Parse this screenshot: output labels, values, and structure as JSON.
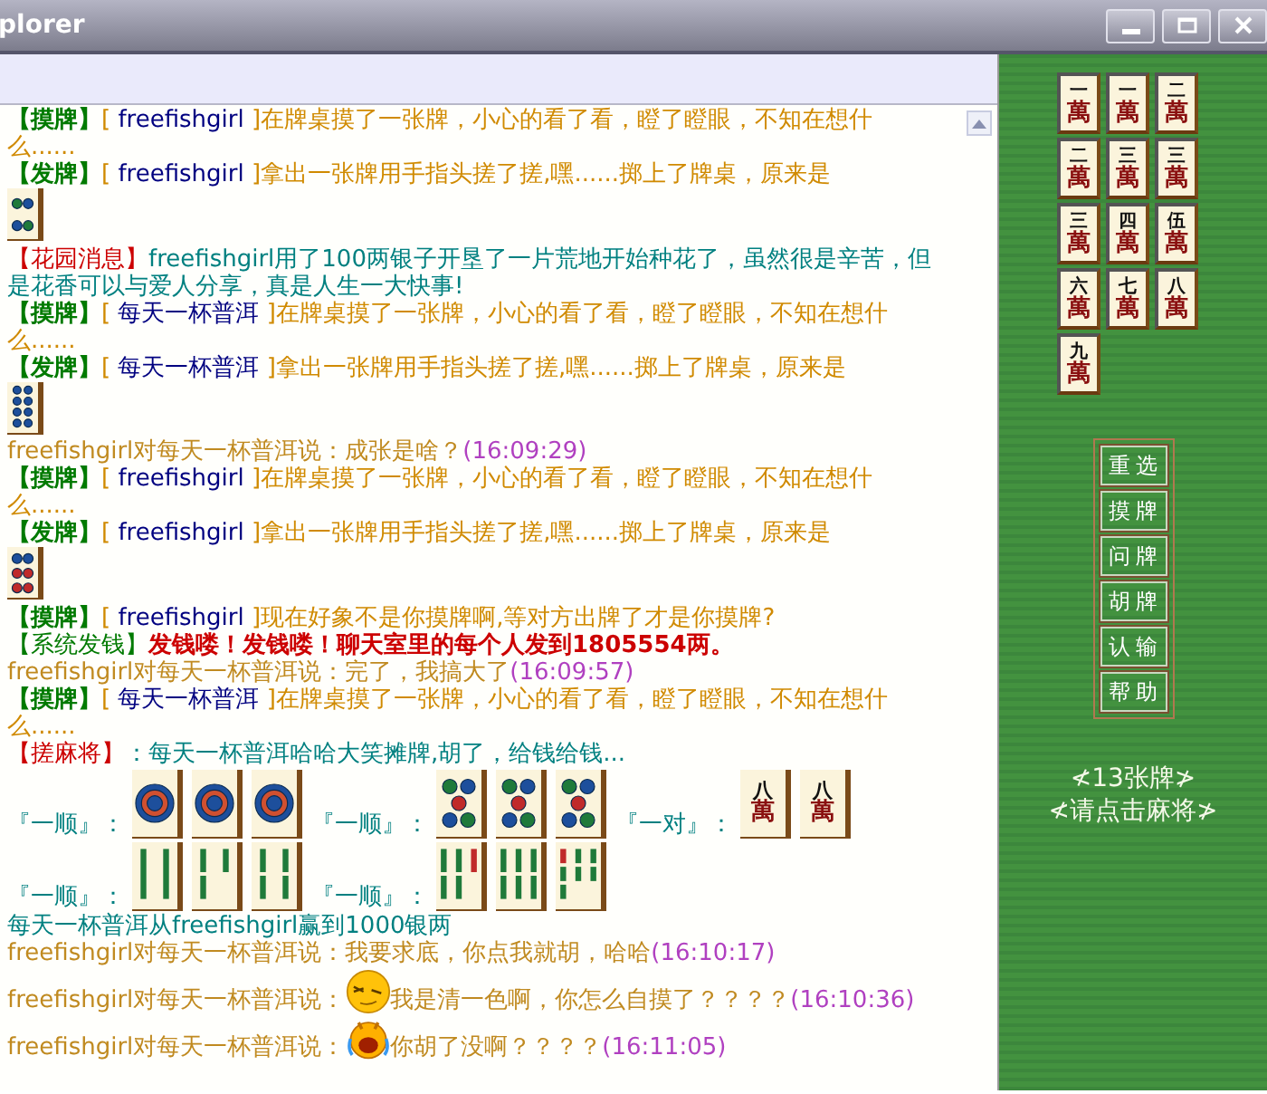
{
  "window": {
    "title": "plorer"
  },
  "window_controls": [
    {
      "kind": "minimize"
    },
    {
      "kind": "maximize"
    },
    {
      "kind": "close"
    }
  ],
  "chat": {
    "lines": [
      {
        "kind": "action",
        "tag": "【摸牌】",
        "open": "[",
        "player": "freefishgirl",
        "close": "]",
        "text": "在牌桌摸了一张牌，小心的看了看，瞪了瞪眼，不知在想什么......"
      },
      {
        "kind": "action",
        "tag": "【发牌】",
        "open": "[",
        "player": "freefishgirl",
        "close": "]",
        "text": "拿出一张牌用手指头搓了搓,嘿......掷上了牌桌，原来是",
        "tile": {
          "kind": "dots",
          "pips": [
            {
              "color": "#1f7a3a"
            },
            {
              "color": "#1d4f9c"
            },
            {
              "color": "#1d4f9c"
            },
            {
              "color": "#1f7a3a"
            }
          ]
        }
      },
      {
        "kind": "garden",
        "tag": "【花园消息】",
        "text": "freefishgirl用了100两银子开垦了一片荒地开始种花了，虽然很是辛苦，但是花香可以与爱人分享，真是人生一大快事!"
      },
      {
        "kind": "action",
        "tag": "【摸牌】",
        "open": "[",
        "player": "每天一杯普洱",
        "close": "]",
        "text": "在牌桌摸了一张牌，小心的看了看，瞪了瞪眼，不知在想什么......"
      },
      {
        "kind": "action",
        "tag": "【发牌】",
        "open": "[",
        "player": "每天一杯普洱",
        "close": "]",
        "text": "拿出一张牌用手指头搓了搓,嘿......掷上了牌桌，原来是",
        "tile": {
          "kind": "dots",
          "pips": [
            {
              "color": "#1d4f9c"
            },
            {
              "color": "#1d4f9c"
            },
            {
              "color": "#1d4f9c"
            },
            {
              "color": "#1d4f9c"
            },
            {
              "color": "#1d4f9c"
            },
            {
              "color": "#1d4f9c"
            },
            {
              "color": "#1d4f9c"
            },
            {
              "color": "#1d4f9c"
            }
          ]
        }
      },
      {
        "kind": "chat",
        "sender": "freefishgirl对每天一杯普洱说：",
        "message": "成张是啥？",
        "time": "(16:09:29)"
      },
      {
        "kind": "action",
        "tag": "【摸牌】",
        "open": "[",
        "player": "freefishgirl",
        "close": "]",
        "text": "在牌桌摸了一张牌，小心的看了看，瞪了瞪眼，不知在想什么......"
      },
      {
        "kind": "action",
        "tag": "【发牌】",
        "open": "[",
        "player": "freefishgirl",
        "close": "]",
        "text": "拿出一张牌用手指头搓了搓,嘿......掷上了牌桌，原来是",
        "tile": {
          "kind": "dots",
          "pips": [
            {
              "color": "#1d4f9c"
            },
            {
              "color": "#1d4f9c"
            },
            {
              "color": "#c02a2a"
            },
            {
              "color": "#c02a2a"
            },
            {
              "color": "#c02a2a"
            },
            {
              "color": "#c02a2a"
            }
          ]
        }
      },
      {
        "kind": "action",
        "tag": "【摸牌】",
        "open": "[",
        "player": "freefishgirl",
        "close": "]",
        "text": "现在好象不是你摸牌啊,等对方出牌了才是你摸牌?"
      },
      {
        "kind": "payout",
        "tag": "【系统发钱】",
        "text": "发钱喽！发钱喽！聊天室里的每个人发到1805554两。"
      },
      {
        "kind": "chat",
        "sender": "freefishgirl对每天一杯普洱说：",
        "message": "完了，我搞大了",
        "time": "(16:09:57)"
      },
      {
        "kind": "action",
        "tag": "【摸牌】",
        "open": "[",
        "player": "每天一杯普洱",
        "close": "]",
        "text": "在牌桌摸了一张牌，小心的看了看，瞪了瞪眼，不知在想什么......"
      },
      {
        "kind": "win",
        "tag": "【搓麻将】",
        "text": "：每天一杯普洱哈哈大笑摊牌,胡了，给钱给钱..."
      },
      {
        "kind": "melds",
        "groups": [
          {
            "label": "『一顺』：",
            "tiles": [
              {
                "kind": "dots",
                "pips": [
                  {
                    "color": "#1d4f9c"
                  }
                ]
              },
              {
                "kind": "dots",
                "pips": [
                  {
                    "color": "#1d4f9c"
                  }
                ]
              },
              {
                "kind": "dots",
                "pips": [
                  {
                    "color": "#1d4f9c"
                  }
                ]
              }
            ]
          },
          {
            "label": "『一顺』：",
            "tiles": [
              {
                "kind": "dots",
                "pips": [
                  {
                    "color": "#1f7a3a"
                  },
                  {
                    "color": "#1d4f9c"
                  },
                  {
                    "color": "#c02a2a"
                  },
                  {
                    "color": "#1d4f9c"
                  },
                  {
                    "color": "#1f7a3a"
                  }
                ]
              },
              {
                "kind": "dots",
                "pips": [
                  {
                    "color": "#1f7a3a"
                  },
                  {
                    "color": "#1d4f9c"
                  },
                  {
                    "color": "#c02a2a"
                  },
                  {
                    "color": "#1d4f9c"
                  },
                  {
                    "color": "#1f7a3a"
                  }
                ]
              },
              {
                "kind": "dots",
                "pips": [
                  {
                    "color": "#1f7a3a"
                  },
                  {
                    "color": "#1d4f9c"
                  },
                  {
                    "color": "#c02a2a"
                  },
                  {
                    "color": "#1d4f9c"
                  },
                  {
                    "color": "#1f7a3a"
                  }
                ]
              }
            ]
          },
          {
            "label": "『一对』：",
            "tiles": [
              {
                "kind": "characters",
                "rank": "八",
                "mark": "萬"
              },
              {
                "kind": "characters",
                "rank": "八",
                "mark": "萬"
              }
            ]
          },
          {
            "label": "『一顺』：",
            "tiles": [
              {
                "kind": "bamboo",
                "pips": [
                  {
                    "color": "#1f7a3a"
                  },
                  {
                    "color": "#1f7a3a"
                  }
                ]
              },
              {
                "kind": "bamboo",
                "pips": [
                  {
                    "color": "#1f7a3a"
                  },
                  {
                    "color": "#1f7a3a"
                  },
                  {
                    "color": "#1f7a3a"
                  }
                ]
              },
              {
                "kind": "bamboo",
                "pips": [
                  {
                    "color": "#1f7a3a"
                  },
                  {
                    "color": "#1f7a3a"
                  },
                  {
                    "color": "#1f7a3a"
                  },
                  {
                    "color": "#1f7a3a"
                  }
                ]
              }
            ]
          },
          {
            "label": "『一顺』：",
            "tiles": [
              {
                "kind": "bamboo",
                "pips": [
                  {
                    "color": "#1f7a3a"
                  },
                  {
                    "color": "#1f7a3a"
                  },
                  {
                    "color": "#c02a2a"
                  },
                  {
                    "color": "#1f7a3a"
                  },
                  {
                    "color": "#1f7a3a"
                  }
                ]
              },
              {
                "kind": "bamboo",
                "pips": [
                  {
                    "color": "#1f7a3a"
                  },
                  {
                    "color": "#1f7a3a"
                  },
                  {
                    "color": "#1f7a3a"
                  },
                  {
                    "color": "#1f7a3a"
                  },
                  {
                    "color": "#1f7a3a"
                  },
                  {
                    "color": "#1f7a3a"
                  }
                ]
              },
              {
                "kind": "bamboo",
                "pips": [
                  {
                    "color": "#c02a2a"
                  },
                  {
                    "color": "#1f7a3a"
                  },
                  {
                    "color": "#1f7a3a"
                  },
                  {
                    "color": "#1f7a3a"
                  },
                  {
                    "color": "#1f7a3a"
                  },
                  {
                    "color": "#1f7a3a"
                  },
                  {
                    "color": "#1f7a3a"
                  }
                ]
              }
            ]
          }
        ]
      },
      {
        "kind": "result",
        "text": "每天一杯普洱从freefishgirl赢到1000银两"
      },
      {
        "kind": "chat",
        "sender": "freefishgirl对每天一杯普洱说：",
        "message": "我要求底，你点我就胡，哈哈",
        "time": "(16:10:17)"
      },
      {
        "kind": "chat",
        "sender": "freefishgirl对每天一杯普洱说：",
        "emoticon": {
          "kind": "sleepy"
        },
        "message": "我是清一色啊，你怎么自摸了？？？？",
        "time": "(16:10:36)"
      },
      {
        "kind": "chat",
        "sender": "freefishgirl对每天一杯普洱说：",
        "emoticon": {
          "kind": "crying"
        },
        "message": "你胡了没啊？？？？",
        "time": "(16:11:05)"
      }
    ]
  },
  "hand": {
    "tiles": [
      {
        "rank": "一",
        "mark": "萬"
      },
      {
        "rank": "一",
        "mark": "萬"
      },
      {
        "rank": "二",
        "mark": "萬"
      },
      {
        "rank": "二",
        "mark": "萬"
      },
      {
        "rank": "三",
        "mark": "萬"
      },
      {
        "rank": "三",
        "mark": "萬"
      },
      {
        "rank": "三",
        "mark": "萬"
      },
      {
        "rank": "四",
        "mark": "萬"
      },
      {
        "rank": "伍",
        "mark": "萬"
      },
      {
        "rank": "六",
        "mark": "萬"
      },
      {
        "rank": "七",
        "mark": "萬"
      },
      {
        "rank": "八",
        "mark": "萬"
      },
      {
        "rank": "九",
        "mark": "萬"
      }
    ]
  },
  "buttons": [
    {
      "label": "重选"
    },
    {
      "label": "摸牌"
    },
    {
      "label": "问牌"
    },
    {
      "label": "胡牌"
    },
    {
      "label": "认输"
    },
    {
      "label": "帮助"
    }
  ],
  "hints": [
    "≮13张牌≯",
    "≮请点击麻将≯"
  ]
}
